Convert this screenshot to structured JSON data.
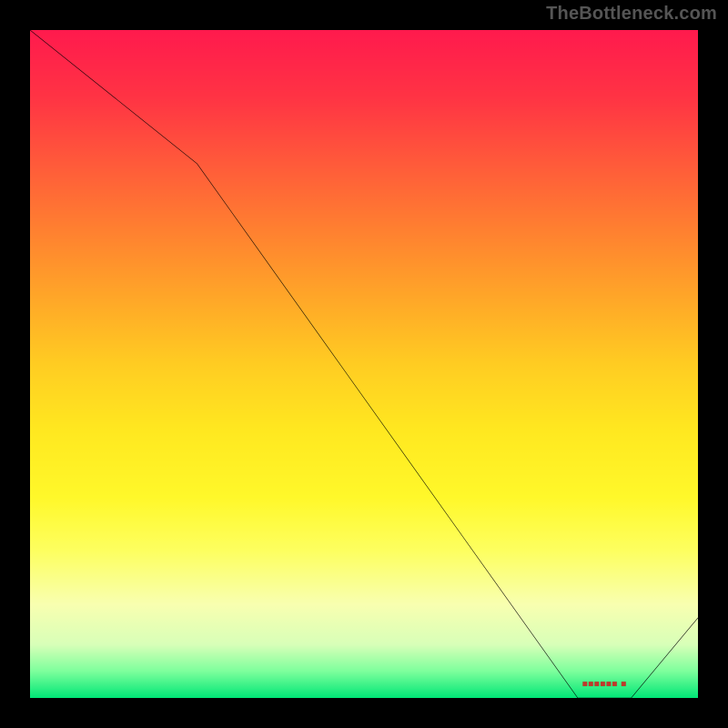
{
  "attribution": "TheBottleneck.com",
  "colors": {
    "page_bg": "#000000",
    "frame_border": "#000000",
    "curve": "#000000",
    "attribution_text": "#555555",
    "marker_text": "#c0392b",
    "gradient_top": "#ff1a4d",
    "gradient_bottom": "#00e676"
  },
  "chart_data": {
    "type": "line",
    "title": "",
    "xlabel": "",
    "ylabel": "",
    "xlim": [
      0,
      100
    ],
    "ylim": [
      0,
      100
    ],
    "grid": false,
    "legend": false,
    "series": [
      {
        "name": "curve",
        "x": [
          0,
          25,
          82,
          90,
          100
        ],
        "values": [
          100,
          80,
          0,
          0,
          12
        ]
      }
    ],
    "marker": {
      "x": 86,
      "y": 2,
      "label": "■■■■■■ ■"
    }
  }
}
